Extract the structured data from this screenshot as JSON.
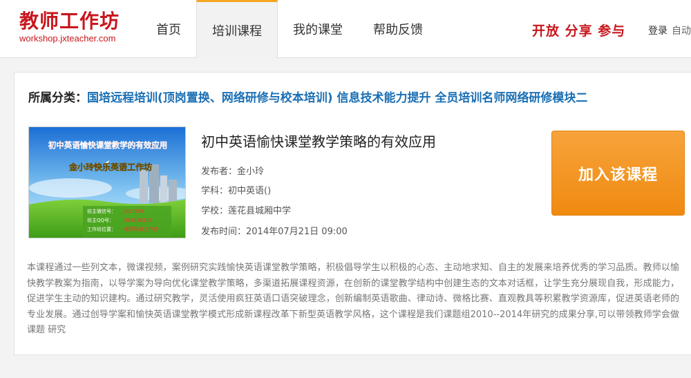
{
  "header": {
    "logo_title": "教师工作坊",
    "logo_url": "workshop.jxteacher.com",
    "nav": [
      {
        "label": "首页"
      },
      {
        "label": "培训课程"
      },
      {
        "label": "我的课堂"
      },
      {
        "label": "帮助反馈"
      }
    ],
    "active_nav": "培训课程",
    "slogan": "开放 分享 参与",
    "login_label": "登录",
    "auto_label": "自动"
  },
  "course": {
    "category_label": "所属分类：",
    "category_value": "国培远程培训(顶岗置换、网络研修与校本培训) 信息技术能力提升 全员培训名师网络研修模块二",
    "title": "初中英语愉快课堂教学策略的有效应用",
    "publisher": "发布者：金小玲",
    "subject": "学科：初中英语()",
    "school": "学校：莲花县城厢中学",
    "published": "发布时间：2014年07月21日 09:00",
    "join_label": "加入该课程",
    "cover": {
      "title": "初中英语愉快课堂教学的有效应用",
      "subtitle": "金小玲快乐英语工作坊",
      "info": [
        {
          "k": "坊主微信号：",
          "v": "JXL7896"
        },
        {
          "k": "坊主QQ号：",
          "v": "984388127"
        },
        {
          "k": "工作坊位置：",
          "v": "教学研修工作坊"
        }
      ]
    },
    "description": "本课程通过一些列文本，微课视频，案例研究实践愉快英语课堂教学策略，积极倡导学生以积极的心态、主动地求知、自主的发展来培养优秀的学习品质。教师以愉快教学教案为指南，以导学案为导向优化课堂教学策略，多渠道拓展课程资源，在创新的课堂教学结构中创建生态的文本对话框，让学生充分展现自我，形成能力，促进学生主动的知识建构。通过研究教学，灵活使用疯狂英语口语突破理念，创新编制英语歌曲、律动诗、微格比赛、直观教具等积累教学资源库，促进英语老师的专业发展。通过创导学案和愉快英语课堂教学模式形成新课程改革下新型英语教学风格，这个课程是我们课题组2010--2014年研究的成果分享,可以带领教师学会做课题 研究"
  },
  "colors": {
    "brand_red": "#c8161d",
    "link_blue": "#1a6fb4",
    "button_orange": "#f08a10",
    "nav_accent": "#f5a623"
  }
}
